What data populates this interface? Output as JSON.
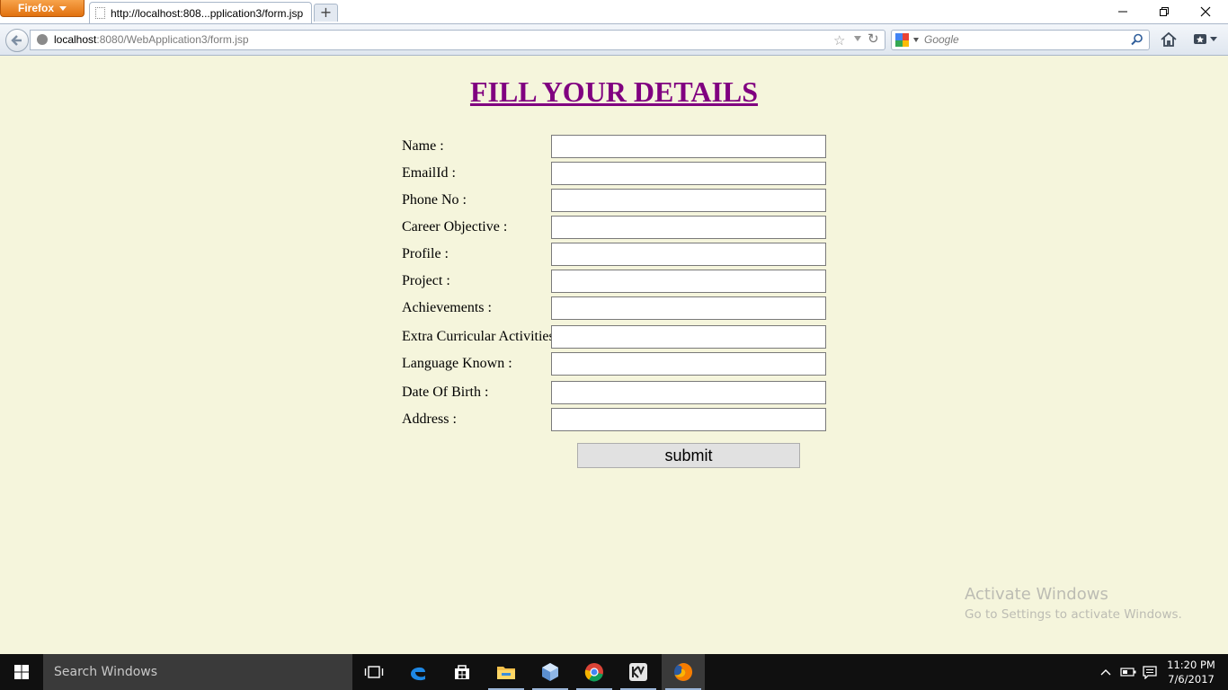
{
  "browser": {
    "menu_button_label": "Firefox",
    "tab_title": "http://localhost:808...pplication3/form.jsp",
    "new_tab_label": "+",
    "url_host": "localhost",
    "url_rest": ":8080/WebApplication3/form.jsp",
    "search_placeholder": "Google",
    "window_controls": [
      "minimize-icon",
      "restore-icon",
      "close-icon"
    ]
  },
  "page": {
    "title": "FILL YOUR DETAILS",
    "fields": [
      {
        "label": "Name :",
        "value": ""
      },
      {
        "label": "EmailId :",
        "value": ""
      },
      {
        "label": "Phone No :",
        "value": ""
      },
      {
        "label": "Career Objective :",
        "value": ""
      },
      {
        "label": "Profile :",
        "value": ""
      },
      {
        "label": "Project :",
        "value": ""
      },
      {
        "label": "Achievements :",
        "value": ""
      },
      {
        "label": "Extra Curricular Activities :",
        "value": ""
      },
      {
        "label": "Language Known :",
        "value": ""
      },
      {
        "label": "Date Of Birth :",
        "value": ""
      },
      {
        "label": "Address :",
        "value": ""
      }
    ],
    "submit_label": "submit"
  },
  "watermark": {
    "line1": "Activate Windows",
    "line2": "Go to Settings to activate Windows."
  },
  "taskbar": {
    "search_placeholder": "Search Windows",
    "apps": [
      "task-view-icon",
      "edge-icon",
      "store-icon",
      "file-explorer-icon",
      "virtualbox-icon",
      "chrome-icon",
      "kmplayer-icon",
      "firefox-icon"
    ],
    "clock_time": "11:20 PM",
    "clock_date": "7/6/2017"
  },
  "colors": {
    "page_background": "#f5f5dc",
    "title_color": "#800080",
    "taskbar": "#101010"
  }
}
